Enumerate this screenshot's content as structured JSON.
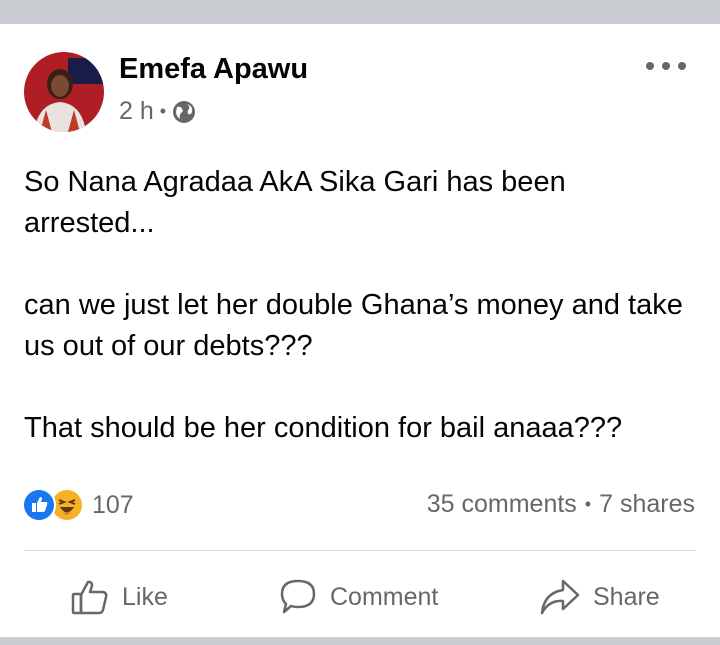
{
  "post": {
    "author": "Emefa Apawu",
    "time": "2 h",
    "meta_separator": "•",
    "privacy_icon": "globe-icon",
    "paragraphs": [
      "So Nana Agradaa AkA Sika Gari has been arrested...",
      "can we just let her double Ghana’s money and take us out of our debts???",
      "That should be her condition for bail anaaa???"
    ]
  },
  "engagement": {
    "reaction_icons": [
      "like-icon",
      "haha-icon"
    ],
    "reaction_count": "107",
    "comments": "35 comments",
    "separator": "•",
    "shares": "7 shares"
  },
  "actions": {
    "like": "Like",
    "comment": "Comment",
    "share": "Share"
  },
  "colors": {
    "background": "#c9ccd1",
    "secondary_text": "#65676b",
    "like_blue": "#1877f2",
    "haha_yellow": "#f7b125"
  }
}
